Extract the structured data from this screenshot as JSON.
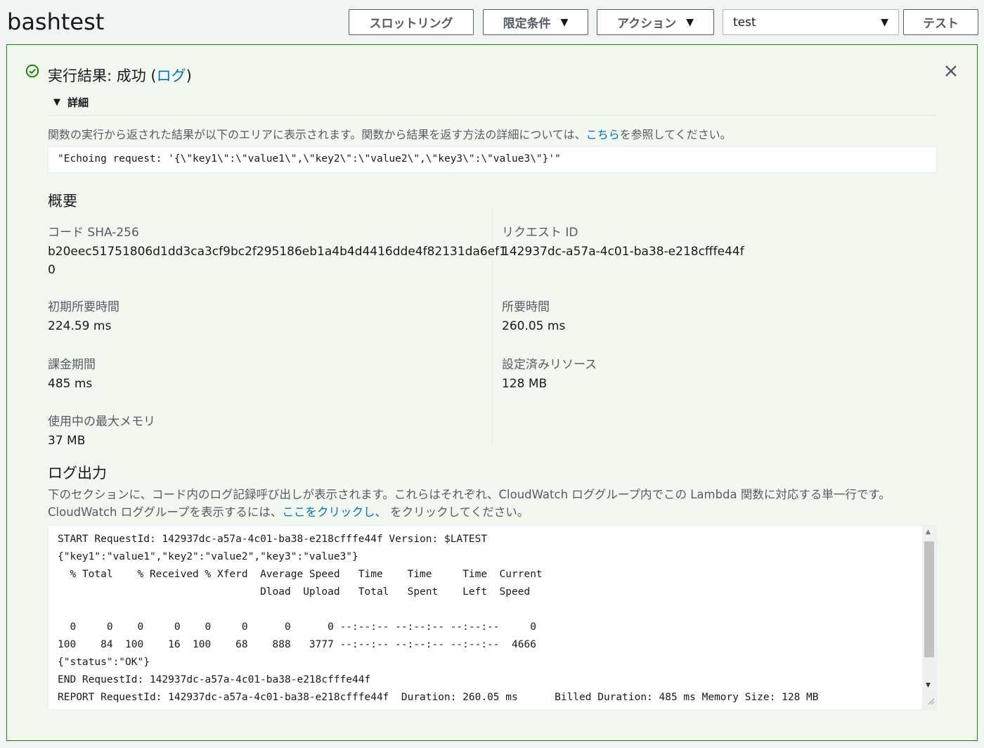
{
  "header": {
    "title": "bashtest",
    "throttle_label": "スロットリング",
    "qualifier_label": "限定条件",
    "actions_label": "アクション",
    "test_event_value": "test",
    "test_button_label": "テスト"
  },
  "result": {
    "status_prefix": "実行結果: 成功 (",
    "log_link": "ログ",
    "status_suffix": ")",
    "details_label": "詳細",
    "description_text": "関数の実行から返された結果が以下のエリアに表示されます。関数から結果を返す方法の詳細については、",
    "description_link": "こちら",
    "description_suffix": "を参照してください。",
    "output": "\"Echoing request: '{\\\"key1\\\":\\\"value1\\\",\\\"key2\\\":\\\"value2\\\",\\\"key3\\\":\\\"value3\\\"}'\""
  },
  "summary": {
    "heading": "概要",
    "code_sha_label": "コード SHA-256",
    "code_sha_value_line1": "b20eec51751806d1dd3ca3cf9bc2f295186eb1a4b4d4416dde4f82131da6ef1",
    "code_sha_value_line2": "0",
    "request_id_label": "リクエスト ID",
    "request_id_value": "142937dc-a57a-4c01-ba38-e218cfffe44f",
    "init_duration_label": "初期所要時間",
    "init_duration_value": "224.59 ms",
    "duration_label": "所要時間",
    "duration_value": "260.05 ms",
    "billed_label": "課金期間",
    "billed_value": "485 ms",
    "resources_label": "設定済みリソース",
    "resources_value": "128 MB",
    "max_memory_label": "使用中の最大メモリ",
    "max_memory_value": "37 MB"
  },
  "log": {
    "heading": "ログ出力",
    "desc_line1": "下のセクションに、コード内のログ記録呼び出しが表示されます。これらはそれぞれ、CloudWatch ロググループ内でこの Lambda 関数に対応する単一行です。",
    "desc_line2_prefix": "CloudWatch ロググループを表示するには、",
    "desc_line2_link": "ここをクリックし、",
    "desc_line2_suffix": " をクリックしてください。",
    "output": "START RequestId: 142937dc-a57a-4c01-ba38-e218cfffe44f Version: $LATEST\n{\"key1\":\"value1\",\"key2\":\"value2\",\"key3\":\"value3\"}\n  % Total    % Received % Xferd  Average Speed   Time    Time     Time  Current\n                                 Dload  Upload   Total   Spent    Left  Speed\n\n  0     0    0     0    0     0      0      0 --:--:-- --:--:-- --:--:--     0\n100    84  100    16  100    68    888   3777 --:--:-- --:--:-- --:--:--  4666\n{\"status\":\"OK\"}\nEND RequestId: 142937dc-a57a-4c01-ba38-e218cfffe44f\nREPORT RequestId: 142937dc-a57a-4c01-ba38-e218cfffe44f  Duration: 260.05 ms      Billed Duration: 485 ms Memory Size: 128 MB"
  },
  "colors": {
    "success": "#1d8102",
    "link": "#0073bb",
    "panel_bg": "#f2f8f0"
  },
  "icons": {
    "status": "check-circle-icon",
    "close": "close-icon",
    "dropdown": "caret-down-icon"
  }
}
